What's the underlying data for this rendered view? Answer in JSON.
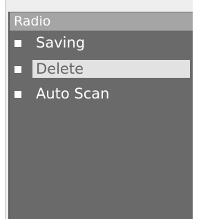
{
  "menu": {
    "title": "Radio",
    "items": [
      {
        "label": "Saving",
        "selected": false
      },
      {
        "label": "Delete",
        "selected": true
      },
      {
        "label": "Auto Scan",
        "selected": false
      }
    ]
  },
  "colors": {
    "screen_bg": "#6a6a6a",
    "title_bg": "#a5a5a5",
    "highlight_bg": "#e2e2e2",
    "text": "#ffffff",
    "selected_text": "#666666"
  }
}
